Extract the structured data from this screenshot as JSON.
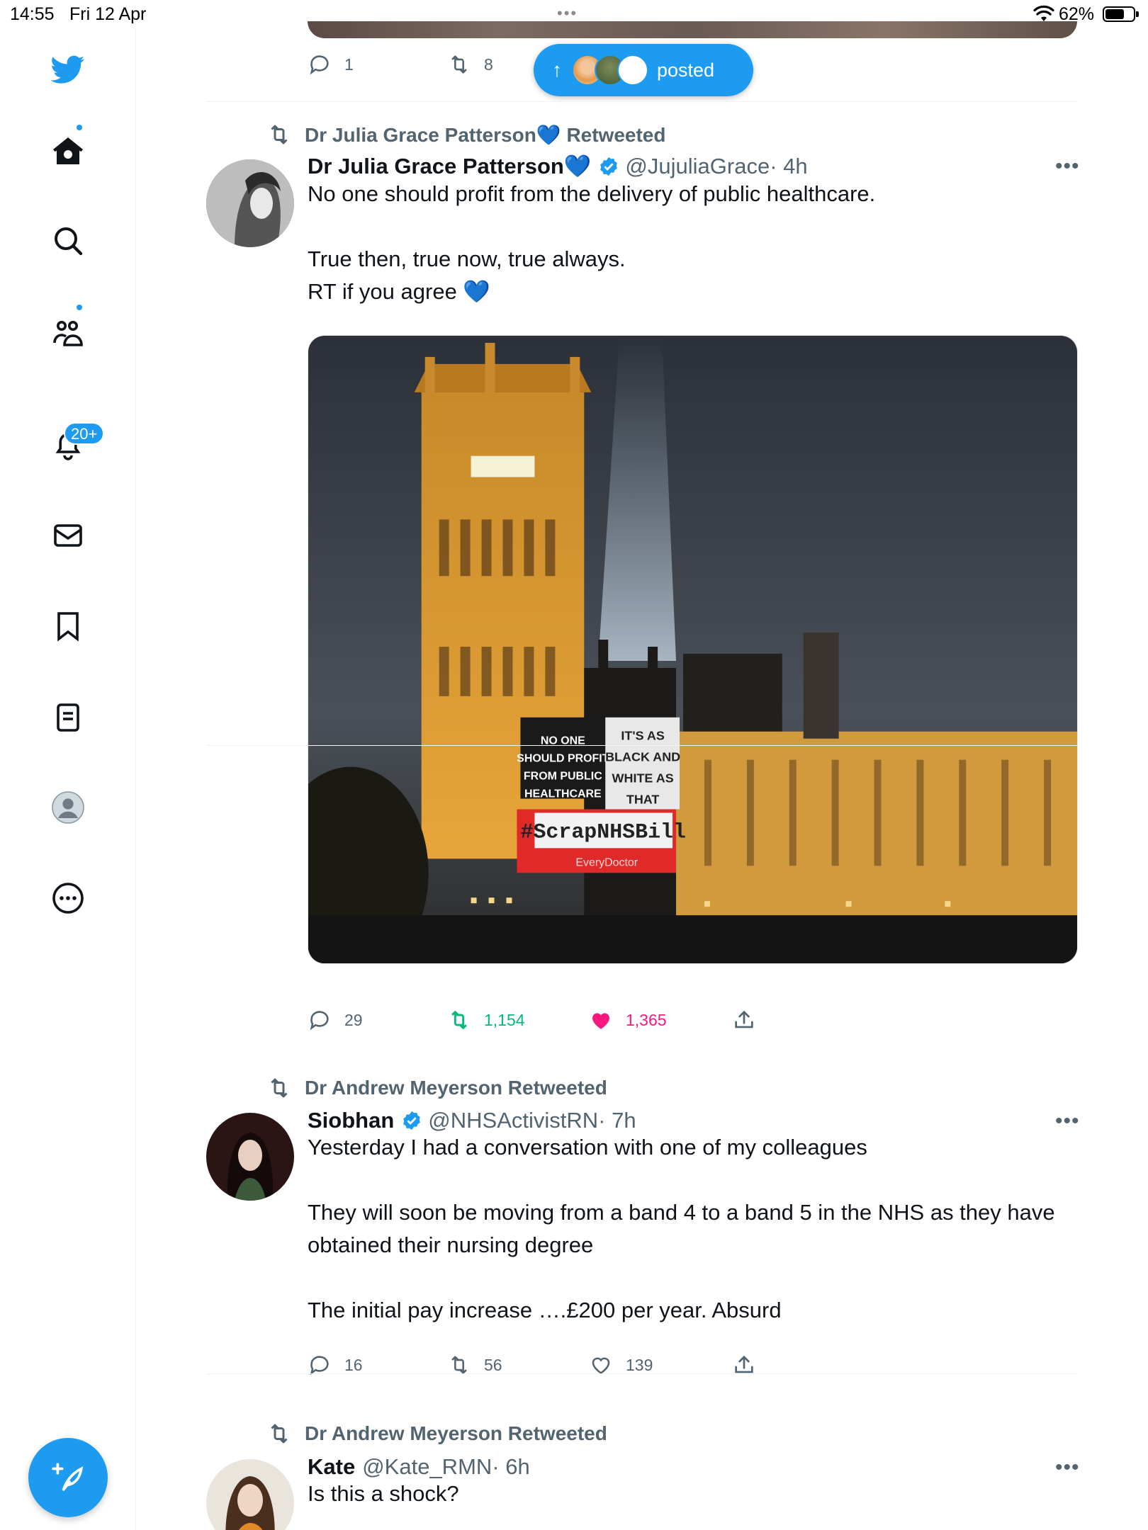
{
  "status_bar": {
    "time": "14:55",
    "date": "Fri 12 Apr",
    "dots": "•••",
    "battery": "62%"
  },
  "sidebar": {
    "notifications_badge": "20+"
  },
  "prev_tweet": {
    "replies": "1",
    "retweets": "8"
  },
  "posted_pill": {
    "label": "posted",
    "arrow": "↑"
  },
  "tweets": [
    {
      "retweeted_by": "Dr Julia Grace Patterson💙 Retweeted",
      "name": "Dr Julia Grace Patterson💙",
      "handle": "@JujuliaGrace",
      "time": "· 4h",
      "text": "No one should profit from the delivery of public healthcare.\n\nTrue then, true now, true always.\nRT if you agree 💙",
      "media": {
        "projection_left": [
          "NO ONE",
          "SHOULD PROFIT",
          "FROM PUBLIC",
          "HEALTHCARE"
        ],
        "projection_right": [
          "IT'S AS",
          "BLACK AND",
          "WHITE AS",
          "THAT"
        ],
        "hashtag": "#ScrapNHSBill",
        "brand": "EveryDoctor"
      },
      "replies": "29",
      "retweets": "1,154",
      "likes": "1,365"
    },
    {
      "retweeted_by": "Dr Andrew Meyerson Retweeted",
      "name": "Siobhan",
      "handle": "@NHSActivistRN",
      "time": "· 7h",
      "text": "Yesterday I had a conversation with one of my colleagues\n\nThey will soon be moving from a band 4 to a band 5 in the NHS as they have obtained their nursing degree\n\nThe initial pay increase ….£200 per year. Absurd",
      "replies": "16",
      "retweets": "56",
      "likes": "139"
    },
    {
      "retweeted_by": "Dr Andrew Meyerson Retweeted",
      "name": "Kate",
      "handle": "@Kate_RMN",
      "time": "· 6h",
      "text": "Is this a shock?"
    }
  ],
  "colors": {
    "accent": "#1d9bf0",
    "retweet_green": "#00ba7c",
    "like_pink": "#f91880",
    "muted": "#536471"
  },
  "icons": [
    "twitter-logo-icon",
    "home-icon",
    "search-icon",
    "communities-icon",
    "bell-icon",
    "mail-icon",
    "bookmark-icon",
    "lists-icon",
    "profile-icon",
    "more-circle-icon",
    "compose-icon",
    "reply-icon",
    "retweet-icon",
    "like-icon",
    "share-icon",
    "verified-icon"
  ]
}
